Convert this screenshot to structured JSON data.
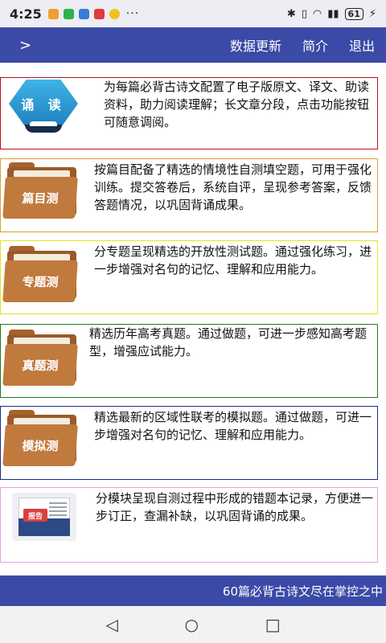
{
  "status": {
    "time": "4:25",
    "dots": "···",
    "battery": "61",
    "signal": "ᵢᵢ",
    "bluetooth": "✱"
  },
  "appbar": {
    "back": ">",
    "menu": [
      "数据更新",
      "简介",
      "退出"
    ]
  },
  "cards": [
    {
      "icon": "reading-icon",
      "label": "诵 读",
      "text": "为每篇必背古诗文配置了电子版原文、译文、助读资料，助力阅读理解；长文章分段，点击功能按钮可随意调阅。",
      "color": "#b8121b"
    },
    {
      "icon": "folder-icon",
      "label": "篇目测",
      "text": "按篇目配备了精选的情境性自测填空题，可用于强化训练。提交答卷后，系统自评，呈现参考答案，反馈答题情况，以巩固背诵成果。",
      "color": "#d9a13a"
    },
    {
      "icon": "folder-icon",
      "label": "专题测",
      "text": "分专题呈现精选的开放性测试题。通过强化练习，进一步增强对名句的记忆、理解和应用能力。",
      "color": "#e6e21a"
    },
    {
      "icon": "folder-icon",
      "label": "真题测",
      "text": "精选历年高考真题。通过做题，可进一步感知高考题型，增强应试能力。",
      "color": "#1f7a1f"
    },
    {
      "icon": "folder-icon",
      "label": "模拟测",
      "text": "精选最新的区域性联考的模拟题。通过做题，可进一步增强对名句的记忆、理解和应用能力。",
      "color": "#1a2a8a"
    },
    {
      "icon": "report-icon",
      "label": "报告",
      "text": "分模块呈现自测过程中形成的错题本记录，方便进一步订正，查漏补缺，以巩固背诵的成果。",
      "color": "#e8a3e0"
    }
  ],
  "ticker": "60篇必背古诗文尽在掌控之中",
  "nav": {
    "back": "◁",
    "home": "○",
    "recents": "□"
  }
}
